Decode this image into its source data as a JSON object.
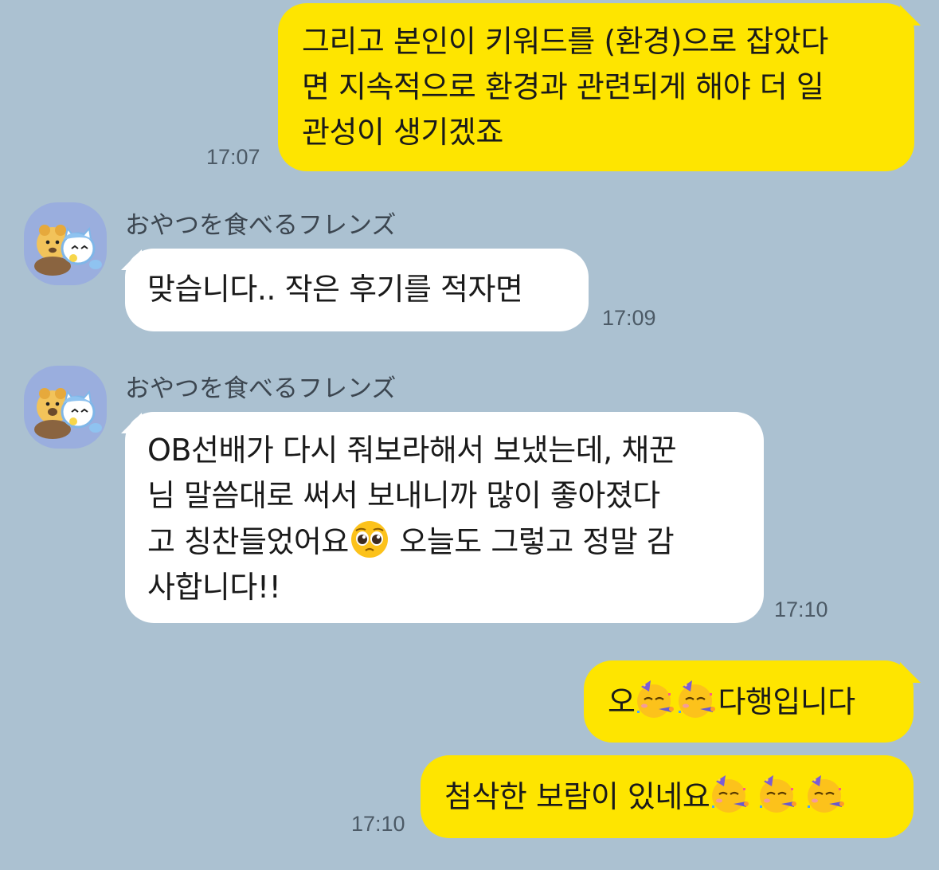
{
  "messages": [
    {
      "side": "me",
      "text_lines": [
        "그리고 본인이 키워드를 (환경)으로 잡았다",
        "면 지속적으로 환경과 관련되게 해야 더 일",
        "관성이 생기겠죠"
      ],
      "time": "17:07"
    },
    {
      "side": "them",
      "sender": "おやつを食べるフレンズ",
      "text": "맞습니다.. 작은 후기를 적자면",
      "time": "17:09"
    },
    {
      "side": "them",
      "sender": "おやつを食べるフレンズ",
      "text_lines": [
        "OB선배가 다시 줘보라해서 보냈는데, 채꾼",
        "님 말씀대로 써서 보내니까 많이 좋아졌다",
        "고 칭찬들었어요",
        " 오늘도 그렇고 정말 감",
        "사합니다!!"
      ],
      "emoji": "pleading-face",
      "time": "17:10"
    },
    {
      "side": "me",
      "parts": [
        "오",
        "다행입니다"
      ],
      "emoji": "partying-face"
    },
    {
      "side": "me",
      "text": "첨삭한 보람이 있네요",
      "emoji": "partying-face",
      "time": "17:10"
    }
  ],
  "colors": {
    "background": "#abc1d1",
    "my_bubble": "#fee500",
    "their_bubble": "#ffffff"
  }
}
